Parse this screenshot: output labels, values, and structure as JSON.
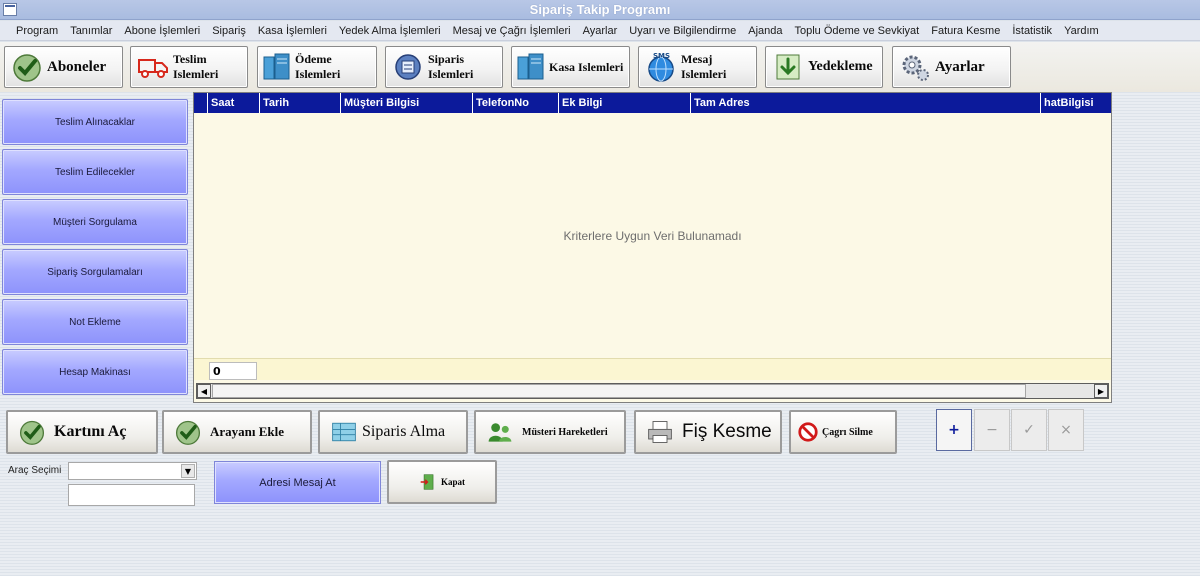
{
  "window": {
    "title": "Sipariş Takip Programı"
  },
  "menu": [
    "Program",
    "Tanımlar",
    "Abone İşlemleri",
    "Sipariş",
    "Kasa İşlemleri",
    "Yedek Alma İşlemleri",
    "Mesaj ve Çağrı İşlemleri",
    "Ayarlar",
    "Uyarı ve Bilgilendirme",
    "Ajanda",
    "Toplu Ödeme ve Sevkiyat",
    "Fatura Kesme",
    "İstatistik",
    "Yardım"
  ],
  "toolbar": {
    "aboneler": "Aboneler",
    "teslim": "Teslim Islemleri",
    "odeme": "Ödeme Islemleri",
    "siparis": "Siparis Islemleri",
    "kasa": "Kasa Islemleri",
    "mesaj": "Mesaj Islemleri",
    "yedekleme": "Yedekleme",
    "ayarlar": "Ayarlar",
    "sms_badge": "SMS"
  },
  "sidebar": [
    "Teslim Alınacaklar",
    "Teslim Edilecekler",
    "Müşteri Sorgulama",
    "Sipariş Sorgulamaları",
    "Not Ekleme",
    "Hesap Makinası"
  ],
  "grid": {
    "columns": [
      "Saat",
      "Tarih",
      "Müşteri Bilgisi",
      "TelefonNo",
      "Ek Bilgi",
      "Tam Adres",
      "hatBilgisi"
    ],
    "empty_message": "Kriterlere Uygun Veri Bulunamadı",
    "row_count": "0"
  },
  "actions": {
    "kartini_ac": "Kartını Aç",
    "arayani_ekle": "Arayanı Ekle",
    "siparis_alma": "Siparis Alma",
    "musteri_hareketleri": "Müsteri Hareketleri",
    "fis_kesme": "Fiş Kesme",
    "cagri_silme": "Çagrı Silme"
  },
  "navigator": {
    "add": "+",
    "remove": "−",
    "post": "✓",
    "cancel": "×"
  },
  "bottom": {
    "arac_label": "Araç Seçimi",
    "arac_value": "",
    "adres_mesaj": "Adresi Mesaj At",
    "kapat": "Kapat"
  },
  "colors": {
    "grid_header": "#0c1a9b",
    "sidebar_button": "#a3a8ff",
    "grid_bg": "#fcf9e6"
  }
}
